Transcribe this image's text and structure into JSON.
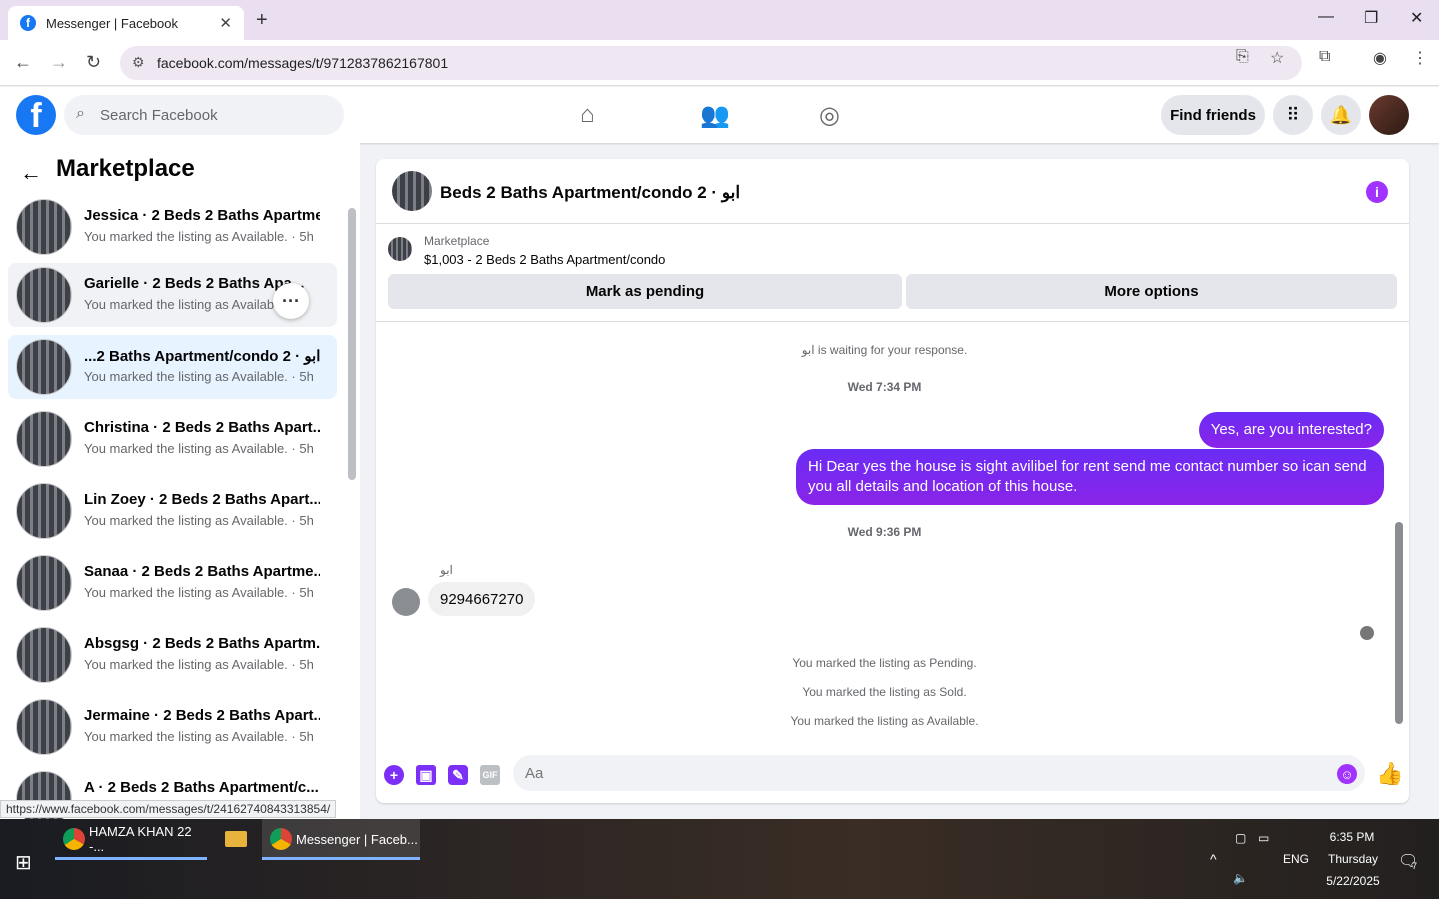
{
  "browser": {
    "tab_title": "Messenger | Facebook",
    "url": "facebook.com/messages/t/9712837862167801",
    "status_url": "https://www.facebook.com/messages/t/24162740843313854/"
  },
  "fb_header": {
    "search_placeholder": "Search Facebook",
    "find_friends": "Find friends"
  },
  "sidebar": {
    "title": "Marketplace",
    "conversations": [
      {
        "name": "Jessica · 2 Beds 2 Baths Apartme...",
        "message": "You marked the listing as Available.",
        "time": "5h"
      },
      {
        "name": "Garielle · 2 Beds 2 Baths Apa...",
        "message": "You marked the listing as Availab",
        "time": ""
      },
      {
        "name": "...2 Baths Apartment/condo 2 · ابو",
        "message": "You marked the listing as Available.",
        "time": "5h"
      },
      {
        "name": "Christina · 2 Beds 2 Baths Apart...",
        "message": "You marked the listing as Available.",
        "time": "5h"
      },
      {
        "name": "Lin Zoey · 2 Beds 2 Baths Apart...",
        "message": "You marked the listing as Available.",
        "time": "5h"
      },
      {
        "name": "Sanaa · 2 Beds 2 Baths Apartme...",
        "message": "You marked the listing as Available.",
        "time": "5h"
      },
      {
        "name": "Absgsg · 2 Beds 2 Baths Apartm...",
        "message": "You marked the listing as Available.",
        "time": "5h"
      },
      {
        "name": "Jermaine · 2 Beds 2 Baths Apart...",
        "message": "You marked the listing as Available.",
        "time": "5h"
      },
      {
        "name": "A · 2 Beds 2 Baths Apartment/c...",
        "message": "",
        "time": ""
      }
    ]
  },
  "chat": {
    "title": "Beds 2 Baths Apartment/condo 2 · ابو",
    "listing_source": "Marketplace",
    "listing_desc": "$1,003 - 2 Beds 2 Baths Apartment/condo",
    "mark_pending": "Mark as pending",
    "more_options": "More options",
    "waiting_text": "ابو is waiting for your response.",
    "time1": "Wed 7:34 PM",
    "out_msg1": "Yes, are you interested?",
    "out_msg2": "Hi Dear yes the house is sight avilibel for rent send me contact number so ican send you all details and location of this house.",
    "time2": "Wed 9:36 PM",
    "sender_name": "ابو",
    "in_msg1": "9294667270",
    "sys_pending": "You marked the listing as Pending.",
    "sys_sold": "You marked the listing as Sold.",
    "sys_available": "You marked the listing as Available.",
    "input_placeholder": "Aa"
  },
  "taskbar": {
    "item1": "HAMZA KHAN 22 -...",
    "item2": "Messenger | Faceb...",
    "lang": "ENG",
    "time": "6:35 PM",
    "day": "Thursday",
    "date": "5/22/2025",
    "notif_count": "7"
  },
  "colors": {
    "fb_blue": "#1877f2",
    "messenger_purple": "#7b2ff7",
    "selected_row": "#e7f3ff"
  }
}
